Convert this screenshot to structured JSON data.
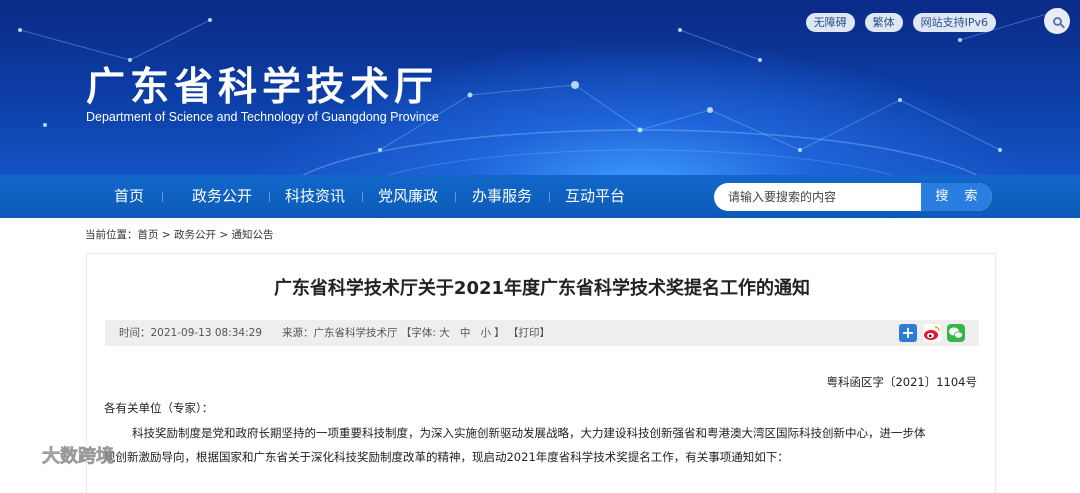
{
  "header": {
    "top_links": [
      "无障碍",
      "繁体",
      "网站支持IPv6"
    ],
    "title": "广东省科学技术厅",
    "subtitle": "Department of Science and Technology of Guangdong Province",
    "search_icon": "search-icon"
  },
  "nav": {
    "items": [
      "首页",
      "政务公开",
      "科技资讯",
      "党风廉政",
      "办事服务",
      "互动平台"
    ],
    "search_placeholder": "请输入要搜索的内容",
    "search_button": "搜 索"
  },
  "breadcrumb": {
    "label": "当前位置：",
    "items": [
      "首页",
      "政务公开",
      "通知公告"
    ],
    "separator": " > "
  },
  "article": {
    "title": "广东省科学技术厅关于2021年度广东省科学技术奖提名工作的通知",
    "meta": {
      "time": "时间：2021-09-13 08:34:29",
      "source": "来源：广东省科学技术厅",
      "font_label": "【字体:",
      "font_large": "大",
      "font_medium": "中",
      "font_small": "小",
      "font_close": "】",
      "print": "【打印】"
    },
    "share_icons": [
      "add-share-icon",
      "weibo-icon",
      "wechat-icon"
    ],
    "doc_number": "粤科函区字〔2021〕1104号",
    "salutation": "各有关单位（专家）：",
    "paragraph_line1": "科技奖励制度是党和政府长期坚持的一项重要科技制度，为深入实施创新驱动发展战略，大力建设科技创新强省和粤港澳大湾区国际科技创新中心，进一步体",
    "paragraph_line2": "现创新激励导向，根据国家和广东省关于深化科技奖励制度改革的精神，现启动2021年度省科学技术奖提名工作，有关事项通知如下："
  },
  "watermark": {
    "text": "大数跨境"
  },
  "colors": {
    "banner_dark": "#0b2a86",
    "nav_blue": "#1167c9",
    "search_button": "#2a7ee0",
    "meta_bg": "#eeeeee",
    "wechat_green": "#36b54a"
  }
}
